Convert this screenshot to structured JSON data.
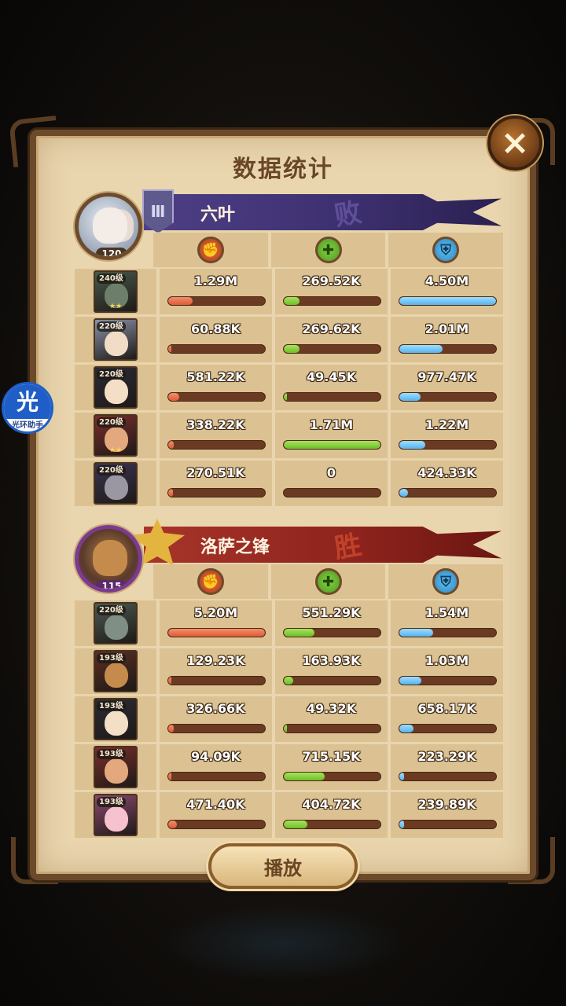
{
  "title": "数据统计",
  "close_icon": "×",
  "play_label": "播放",
  "float_badge": {
    "top": "光",
    "bottom": "光环助手"
  },
  "teams": [
    {
      "name": "六叶",
      "result": "败",
      "level": "120",
      "banner_color": "#3c2f6e",
      "rank_symbol": "Ⅲ",
      "heroes": [
        {
          "level": "240级",
          "stars": "★★",
          "damage": "1.29M",
          "healing": "269.52K",
          "tank": "4.50M",
          "damage_pct": 25,
          "healing_pct": 16,
          "tank_pct": 100,
          "color": "#4a5a4a",
          "face": "#6d7f6a"
        },
        {
          "level": "220级",
          "stars": "",
          "damage": "60.88K",
          "healing": "269.62K",
          "tank": "2.01M",
          "damage_pct": 2,
          "healing_pct": 16,
          "tank_pct": 45,
          "color": "#8a93a8",
          "face": "#f1dcc5"
        },
        {
          "level": "220级",
          "stars": "",
          "damage": "581.22K",
          "healing": "49.45K",
          "tank": "977.47K",
          "damage_pct": 11,
          "healing_pct": 3,
          "tank_pct": 22,
          "color": "#2b2b35",
          "face": "#f3dec6"
        },
        {
          "level": "220级",
          "stars": "★★",
          "damage": "338.22K",
          "healing": "1.71M",
          "tank": "1.22M",
          "damage_pct": 6,
          "healing_pct": 100,
          "tank_pct": 27,
          "color": "#7a2e2a",
          "face": "#e3a87e"
        },
        {
          "level": "220级",
          "stars": "",
          "damage": "270.51K",
          "healing": "0",
          "tank": "424.33K",
          "damage_pct": 5,
          "healing_pct": 0,
          "tank_pct": 9,
          "color": "#3b3550",
          "face": "#9a97a3"
        }
      ]
    },
    {
      "name": "洛萨之锋",
      "result": "胜",
      "level": "115",
      "banner_color": "#8d231c",
      "rank_symbol": "★",
      "heroes": [
        {
          "level": "220级",
          "stars": "",
          "damage": "5.20M",
          "healing": "551.29K",
          "tank": "1.54M",
          "damage_pct": 100,
          "healing_pct": 32,
          "tank_pct": 35,
          "color": "#4d5a52",
          "face": "#7f8f86"
        },
        {
          "level": "193级",
          "stars": "",
          "damage": "129.23K",
          "healing": "163.93K",
          "tank": "1.03M",
          "damage_pct": 3,
          "healing_pct": 10,
          "tank_pct": 23,
          "color": "#5a2e22",
          "face": "#c58b4c"
        },
        {
          "level": "193级",
          "stars": "",
          "damage": "326.66K",
          "healing": "49.32K",
          "tank": "658.17K",
          "damage_pct": 6,
          "healing_pct": 3,
          "tank_pct": 15,
          "color": "#2b2b35",
          "face": "#f3dec6"
        },
        {
          "level": "193级",
          "stars": "",
          "damage": "94.09K",
          "healing": "715.15K",
          "tank": "223.29K",
          "damage_pct": 2,
          "healing_pct": 42,
          "tank_pct": 5,
          "color": "#7a2e2a",
          "face": "#e3a87e"
        },
        {
          "level": "193级",
          "stars": "",
          "damage": "471.40K",
          "healing": "404.72K",
          "tank": "239.89K",
          "damage_pct": 9,
          "healing_pct": 24,
          "tank_pct": 5,
          "color": "#8e4a6e",
          "face": "#f6c2cf"
        }
      ]
    }
  ],
  "stat_types": [
    {
      "key": "damage",
      "icon": "damage-fist-icon",
      "color": "#de5a36"
    },
    {
      "key": "healing",
      "icon": "healing-plus-icon",
      "color": "#6cbf2a"
    },
    {
      "key": "tank",
      "icon": "shield-icon",
      "color": "#56b4ec"
    }
  ]
}
